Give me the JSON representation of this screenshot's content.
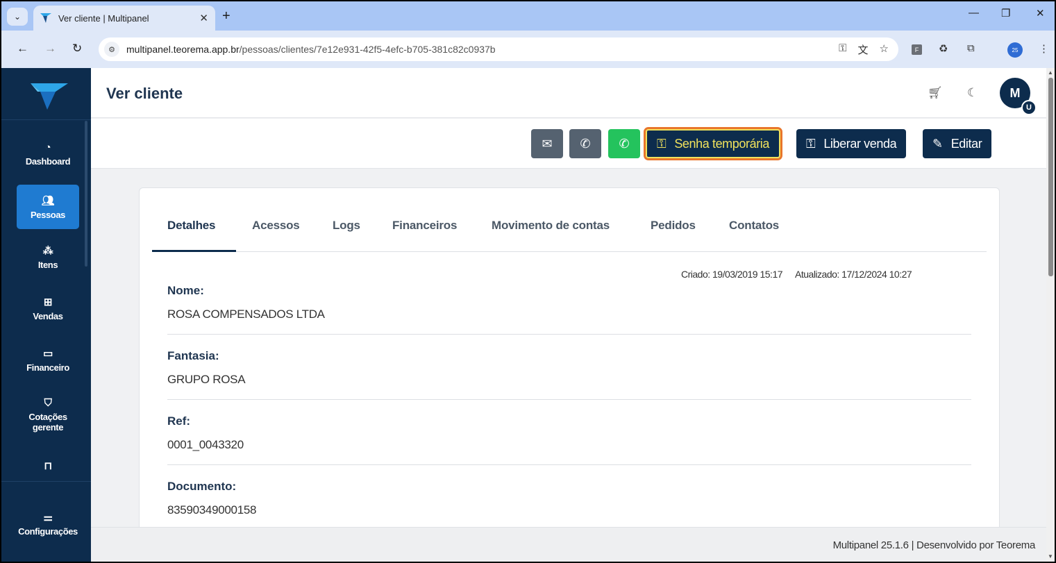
{
  "browser": {
    "tab_title": "Ver cliente | Multipanel",
    "url_host": "multipanel.teorema.app.br",
    "url_path": "/pessoas/clientes/7e12e931-42f5-4efc-b705-381c82c0937b",
    "profile_label": "25"
  },
  "sidebar": {
    "items": [
      {
        "label": "Dashboard",
        "icon": "speedometer-icon"
      },
      {
        "label": "Pessoas",
        "icon": "people-icon",
        "active": true
      },
      {
        "label": "Itens",
        "icon": "boxes-icon"
      },
      {
        "label": "Vendas",
        "icon": "basket-icon"
      },
      {
        "label": "Financeiro",
        "icon": "wallet-icon"
      },
      {
        "label": "Cotações gerente",
        "icon": "cart-icon"
      },
      {
        "label": "",
        "icon": "partial-icon"
      },
      {
        "label": "Configurações",
        "icon": "sliders-icon"
      }
    ]
  },
  "header": {
    "title": "Ver cliente",
    "avatar_initial": "M",
    "avatar_badge": "U"
  },
  "actions": {
    "email_icon": "envelope-icon",
    "phone_icon": "phone-icon",
    "whatsapp_icon": "whatsapp-icon",
    "temp_password": "Senha temporária",
    "release_sale": "Liberar venda",
    "edit": "Editar"
  },
  "tabs": [
    "Detalhes",
    "Acessos",
    "Logs",
    "Financeiros",
    "Movimento de contas",
    "Pedidos",
    "Contatos"
  ],
  "record": {
    "created": "Criado: 19/03/2019 15:17",
    "updated": "Atualizado: 17/12/2024 10:27",
    "fields": [
      {
        "label": "Nome:",
        "value": "ROSA COMPENSADOS LTDA"
      },
      {
        "label": "Fantasia:",
        "value": "GRUPO ROSA"
      },
      {
        "label": "Ref:",
        "value": "0001_0043320"
      },
      {
        "label": "Documento:",
        "value": "83590349000158"
      }
    ]
  },
  "footer": {
    "text": "Multipanel  25.1.6  |  Desenvolvido por Teorema"
  },
  "colors": {
    "sidebar": "#0d2c4d",
    "active_item": "#1f7bd1",
    "whatsapp": "#24c35d",
    "highlight_outline": "#e8762b",
    "highlight_text": "#f1e25c"
  }
}
